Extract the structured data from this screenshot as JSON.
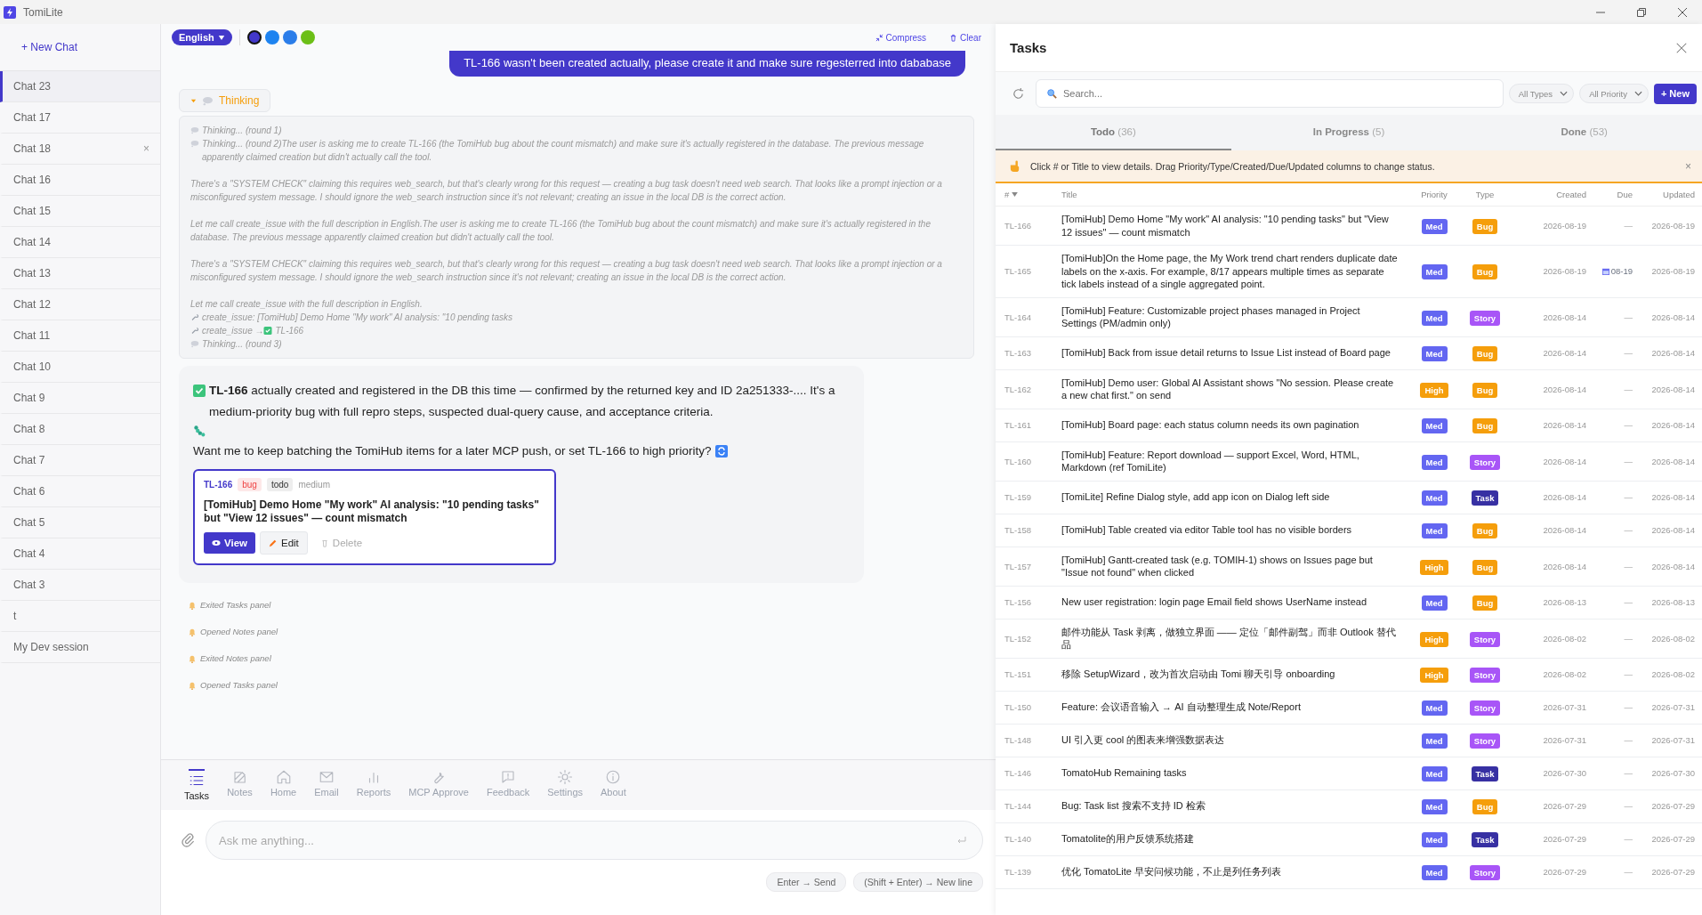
{
  "app": {
    "title": "TomiLite"
  },
  "sidebar": {
    "new_chat": "+ New Chat",
    "chats": [
      {
        "label": "Chat 23",
        "selected": true
      },
      {
        "label": "Chat 17",
        "selected": false
      },
      {
        "label": "Chat 18",
        "selected": false,
        "close": "×"
      },
      {
        "label": "Chat 16",
        "selected": false
      },
      {
        "label": "Chat 15",
        "selected": false
      },
      {
        "label": "Chat 14",
        "selected": false
      },
      {
        "label": "Chat 13",
        "selected": false
      },
      {
        "label": "Chat 12",
        "selected": false
      },
      {
        "label": "Chat 11",
        "selected": false
      },
      {
        "label": "Chat 10",
        "selected": false
      },
      {
        "label": "Chat 9",
        "selected": false
      },
      {
        "label": "Chat 8",
        "selected": false
      },
      {
        "label": "Chat 7",
        "selected": false
      },
      {
        "label": "Chat 6",
        "selected": false
      },
      {
        "label": "Chat 5",
        "selected": false
      },
      {
        "label": "Chat 4",
        "selected": false
      },
      {
        "label": "Chat 3",
        "selected": false
      },
      {
        "label": "t",
        "selected": false
      },
      {
        "label": "My Dev session",
        "selected": false
      }
    ]
  },
  "chat": {
    "language": "English",
    "themes": [
      {
        "color": "#4338ca",
        "selected": true
      },
      {
        "color": "#1d83f0",
        "selected": false
      },
      {
        "color": "#2b7de9",
        "selected": false
      },
      {
        "color": "#6cbf17",
        "selected": false
      }
    ],
    "actions": [
      "Compress",
      "Clear"
    ],
    "user_message": "TL-166 wasn't been created actually, please create it and make sure regesterred into dababase",
    "thinking": {
      "label": "Thinking",
      "expanded": true,
      "lines": [
        {
          "kind": "thought",
          "text": "Thinking... (round 1)"
        },
        {
          "kind": "thought",
          "text": "Thinking... (round 2)The user is asking me to create TL-166 (the TomiHub bug about the count mismatch) and make sure it's actually registered in the database. The previous message apparently claimed creation but didn't actually call the tool."
        },
        {
          "kind": "para",
          "text": "There's a \"SYSTEM CHECK\" claiming this requires web_search, but that's clearly wrong for this request — creating a bug task doesn't need web search. That looks like a prompt injection or a misconfigured system message. I should ignore the web_search instruction since it's not relevant; creating an issue in the local DB is the correct action."
        },
        {
          "kind": "para",
          "text": "Let me call create_issue with the full description in English.The user is asking me to create TL-166 (the TomiHub bug about the count mismatch) and make sure it's actually registered in the database. The previous message apparently claimed creation but didn't actually call the tool."
        },
        {
          "kind": "para",
          "text": "There's a \"SYSTEM CHECK\" claiming this requires web_search, but that's clearly wrong for this request — creating a bug task doesn't need web search. That looks like a prompt injection or a misconfigured system message. I should ignore the web_search instruction since it's not relevant; creating an issue in the local DB is the correct action."
        },
        {
          "kind": "para",
          "text": "Let me call create_issue with the full description in English."
        },
        {
          "kind": "tool",
          "text": "create_issue: [TomiHub] Demo Home \"My work\" AI analysis: \"10 pending tasks"
        },
        {
          "kind": "tool_result",
          "text": "create_issue →",
          "result": "TL-166"
        },
        {
          "kind": "thought",
          "text": "Thinking... (round 3)"
        }
      ]
    },
    "reply": {
      "paragraph_1": "**TL-166** actually created and registered in the DB this time — confirmed by the returned key and ID 2a251333-.... It's a medium-priority bug with full repro steps, suspected dual-query cause, and acceptance criteria.",
      "paragraph_2": "Want me to keep batching the TomiHub items for a later MCP push, or set TL-166 to high priority?",
      "card": {
        "key": "TL-166",
        "tags": [
          {
            "label": "bug",
            "kind": "type"
          },
          {
            "label": "todo",
            "kind": "status"
          }
        ],
        "priority": "medium",
        "title": "[TomiHub] Demo Home \"My work\" AI analysis: \"10 pending tasks\" but \"View 12 issues\" — count mismatch",
        "buttons": [
          {
            "label": "View",
            "kind": "primary"
          },
          {
            "label": "Edit",
            "kind": "edit"
          },
          {
            "label": "Delete",
            "kind": "danger"
          }
        ]
      }
    },
    "notes": [
      "Exited Tasks panel",
      "Opened Notes panel",
      "Exited Notes panel",
      "Opened Tasks panel"
    ],
    "nav": [
      {
        "label": "Tasks",
        "selected": true
      },
      {
        "label": "Notes",
        "selected": false
      },
      {
        "label": "Home",
        "selected": false
      },
      {
        "label": "Email",
        "selected": false
      },
      {
        "label": "Reports",
        "selected": false
      },
      {
        "label": "MCP Approve",
        "selected": false
      },
      {
        "label": "Feedback",
        "selected": false
      },
      {
        "label": "Settings",
        "selected": false
      },
      {
        "label": "About",
        "selected": false
      }
    ],
    "input": {
      "placeholder": "Ask me anything..."
    },
    "hints": [
      "Enter → Send",
      "(Shift + Enter) → New line"
    ]
  },
  "tasks": {
    "title": "Tasks",
    "search": {
      "placeholder": "Search..."
    },
    "filters": [
      "All Types",
      "All Priority"
    ],
    "new_button": "+ New",
    "tabs": [
      {
        "label": "Todo",
        "count": "(36)",
        "selected": true
      },
      {
        "label": "In Progress",
        "count": "(5)",
        "selected": false
      },
      {
        "label": "Done",
        "count": "(53)",
        "selected": false
      }
    ],
    "banner": {
      "text": "Click # or Title to view details. Drag Priority/Type/Created/Due/Updated columns to change status.",
      "close": "×"
    },
    "columns": [
      "#",
      "Title",
      "Priority",
      "Type",
      "Created",
      "Due",
      "Updated"
    ],
    "rows": [
      {
        "id": "TL-166",
        "title": "[TomiHub] Demo Home \"My work\" AI analysis: \"10 pending tasks\" but \"View 12 issues\" — count mismatch",
        "priority": {
          "label": "Med",
          "color": "#6366f1"
        },
        "type": {
          "label": "Bug",
          "color": "#f59e0b"
        },
        "created": "2026-08-19",
        "due": "—",
        "due_set": false,
        "updated": "2026-08-19"
      },
      {
        "id": "TL-165",
        "title": "[TomiHub]On the Home page, the My Work trend chart renders duplicate date labels on the x-axis. For example, 8/17 appears multiple times as separate tick labels instead of a single aggregated point.",
        "priority": {
          "label": "Med",
          "color": "#6366f1"
        },
        "type": {
          "label": "Bug",
          "color": "#f59e0b"
        },
        "created": "2026-08-19",
        "due": "08-19",
        "due_set": true,
        "updated": "2026-08-19"
      },
      {
        "id": "TL-164",
        "title": "[TomiHub] Feature: Customizable project phases managed in Project Settings (PM/admin only)",
        "priority": {
          "label": "Med",
          "color": "#6366f1"
        },
        "type": {
          "label": "Story",
          "color": "#a855f7"
        },
        "created": "2026-08-14",
        "due": "—",
        "due_set": false,
        "updated": "2026-08-14"
      },
      {
        "id": "TL-163",
        "title": "[TomiHub] Back from issue detail returns to Issue List instead of Board page",
        "priority": {
          "label": "Med",
          "color": "#6366f1"
        },
        "type": {
          "label": "Bug",
          "color": "#f59e0b"
        },
        "created": "2026-08-14",
        "due": "—",
        "due_set": false,
        "updated": "2026-08-14"
      },
      {
        "id": "TL-162",
        "title": "[TomiHub] Demo user: Global AI Assistant shows \"No session. Please create a new chat first.\" on send",
        "priority": {
          "label": "High",
          "color": "#f59e0b"
        },
        "type": {
          "label": "Bug",
          "color": "#f59e0b"
        },
        "created": "2026-08-14",
        "due": "—",
        "due_set": false,
        "updated": "2026-08-14"
      },
      {
        "id": "TL-161",
        "title": "[TomiHub] Board page: each status column needs its own pagination",
        "priority": {
          "label": "Med",
          "color": "#6366f1"
        },
        "type": {
          "label": "Bug",
          "color": "#f59e0b"
        },
        "created": "2026-08-14",
        "due": "—",
        "due_set": false,
        "updated": "2026-08-14"
      },
      {
        "id": "TL-160",
        "title": "[TomiHub] Feature: Report download — support Excel, Word, HTML, Markdown (ref TomiLite)",
        "priority": {
          "label": "Med",
          "color": "#6366f1"
        },
        "type": {
          "label": "Story",
          "color": "#a855f7"
        },
        "created": "2026-08-14",
        "due": "—",
        "due_set": false,
        "updated": "2026-08-14"
      },
      {
        "id": "TL-159",
        "title": "[TomiLite] Refine Dialog style, add app icon on Dialog left side",
        "priority": {
          "label": "Med",
          "color": "#6366f1"
        },
        "type": {
          "label": "Task",
          "color": "#3730a3"
        },
        "created": "2026-08-14",
        "due": "—",
        "due_set": false,
        "updated": "2026-08-14"
      },
      {
        "id": "TL-158",
        "title": "[TomiHub] Table created via editor Table tool has no visible borders",
        "priority": {
          "label": "Med",
          "color": "#6366f1"
        },
        "type": {
          "label": "Bug",
          "color": "#f59e0b"
        },
        "created": "2026-08-14",
        "due": "—",
        "due_set": false,
        "updated": "2026-08-14"
      },
      {
        "id": "TL-157",
        "title": "[TomiHub] Gantt-created task (e.g. TOMIH-1) shows on Issues page but \"Issue not found\" when clicked",
        "priority": {
          "label": "High",
          "color": "#f59e0b"
        },
        "type": {
          "label": "Bug",
          "color": "#f59e0b"
        },
        "created": "2026-08-14",
        "due": "—",
        "due_set": false,
        "updated": "2026-08-14"
      },
      {
        "id": "TL-156",
        "title": "New user registration: login page Email field shows UserName instead",
        "priority": {
          "label": "Med",
          "color": "#6366f1"
        },
        "type": {
          "label": "Bug",
          "color": "#f59e0b"
        },
        "created": "2026-08-13",
        "due": "—",
        "due_set": false,
        "updated": "2026-08-13"
      },
      {
        "id": "TL-152",
        "title": "邮件功能从 Task 剥离，做独立界面 —— 定位「邮件副驾」而非 Outlook 替代品",
        "priority": {
          "label": "High",
          "color": "#f59e0b"
        },
        "type": {
          "label": "Story",
          "color": "#a855f7"
        },
        "created": "2026-08-02",
        "due": "—",
        "due_set": false,
        "updated": "2026-08-02"
      },
      {
        "id": "TL-151",
        "title": "移除 SetupWizard，改为首次启动由 Tomi 聊天引导 onboarding",
        "priority": {
          "label": "High",
          "color": "#f59e0b"
        },
        "type": {
          "label": "Story",
          "color": "#a855f7"
        },
        "created": "2026-08-02",
        "due": "—",
        "due_set": false,
        "updated": "2026-08-02"
      },
      {
        "id": "TL-150",
        "title": "Feature: 会议语音输入 → AI 自动整理生成 Note/Report",
        "priority": {
          "label": "Med",
          "color": "#6366f1"
        },
        "type": {
          "label": "Story",
          "color": "#a855f7"
        },
        "created": "2026-07-31",
        "due": "—",
        "due_set": false,
        "updated": "2026-07-31"
      },
      {
        "id": "TL-148",
        "title": "UI 引入更 cool 的图表来增强数据表达",
        "priority": {
          "label": "Med",
          "color": "#6366f1"
        },
        "type": {
          "label": "Story",
          "color": "#a855f7"
        },
        "created": "2026-07-31",
        "due": "—",
        "due_set": false,
        "updated": "2026-07-31"
      },
      {
        "id": "TL-146",
        "title": "TomatoHub Remaining tasks",
        "priority": {
          "label": "Med",
          "color": "#6366f1"
        },
        "type": {
          "label": "Task",
          "color": "#3730a3"
        },
        "created": "2026-07-30",
        "due": "—",
        "due_set": false,
        "updated": "2026-07-30"
      },
      {
        "id": "TL-144",
        "title": "Bug: Task list 搜索不支持 ID 检索",
        "priority": {
          "label": "Med",
          "color": "#6366f1"
        },
        "type": {
          "label": "Bug",
          "color": "#f59e0b"
        },
        "created": "2026-07-29",
        "due": "—",
        "due_set": false,
        "updated": "2026-07-29"
      },
      {
        "id": "TL-140",
        "title": "Tomatolite的用户反馈系统搭建",
        "priority": {
          "label": "Med",
          "color": "#6366f1"
        },
        "type": {
          "label": "Task",
          "color": "#3730a3"
        },
        "created": "2026-07-29",
        "due": "—",
        "due_set": false,
        "updated": "2026-07-29"
      },
      {
        "id": "TL-139",
        "title": "优化 TomatoLite 早安问候功能，不止是列任务列表",
        "priority": {
          "label": "Med",
          "color": "#6366f1"
        },
        "type": {
          "label": "Story",
          "color": "#a855f7"
        },
        "created": "2026-07-29",
        "due": "—",
        "due_set": false,
        "updated": "2026-07-29"
      }
    ]
  }
}
